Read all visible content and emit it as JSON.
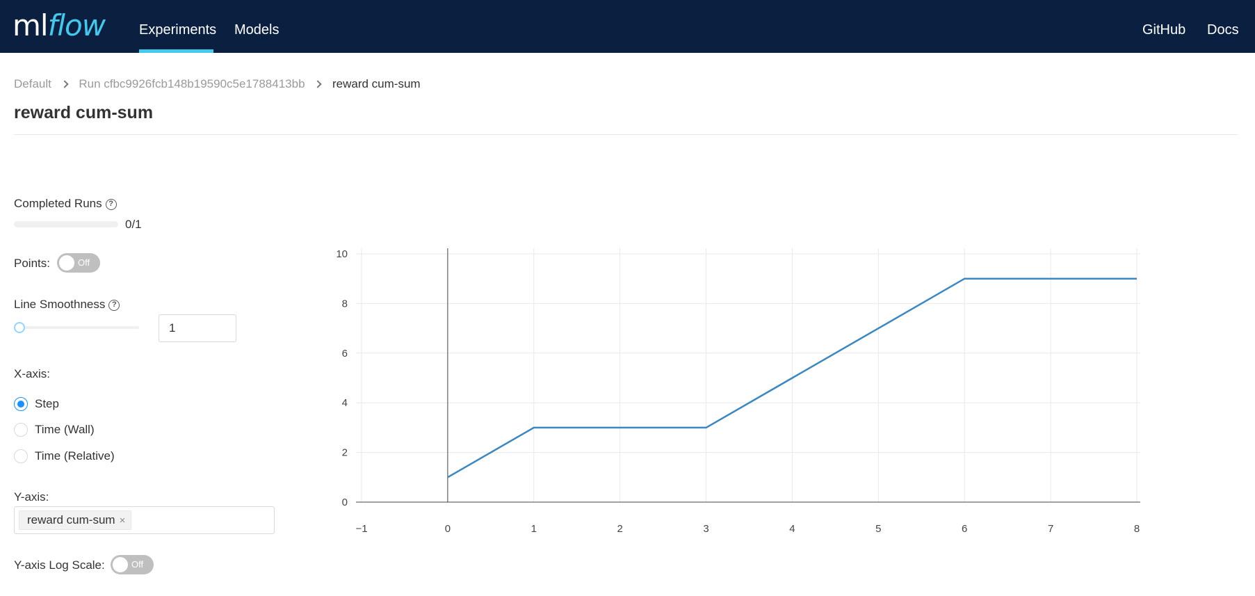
{
  "header": {
    "logo_ml": "ml",
    "logo_flow": "flow",
    "nav_left": [
      "Experiments",
      "Models"
    ],
    "nav_right": [
      "GitHub",
      "Docs"
    ],
    "active_nav": "Experiments",
    "background_color": "#0b2040",
    "accent_color": "#43c9ed"
  },
  "breadcrumb": {
    "items": [
      "Default",
      "Run cfbc9926fcb148b19590c5e1788413bb",
      "reward cum-sum"
    ]
  },
  "page_title": "reward cum-sum",
  "controls": {
    "completed_runs_label": "Completed Runs",
    "completed_runs_value": "0/1",
    "completed_runs_fraction": 0,
    "points_label": "Points:",
    "points_toggle": "Off",
    "line_smoothness_label": "Line Smoothness",
    "line_smoothness_value": "1",
    "xaxis_label": "X-axis:",
    "xaxis_options": [
      "Step",
      "Time (Wall)",
      "Time (Relative)"
    ],
    "xaxis_selected": "Step",
    "yaxis_label": "Y-axis:",
    "yaxis_selected": [
      "reward cum-sum"
    ],
    "yaxis_log_label": "Y-axis Log Scale:",
    "yaxis_log_toggle": "Off"
  },
  "chart_data": {
    "type": "line",
    "x": [
      0,
      1,
      3,
      6,
      8
    ],
    "series": [
      {
        "values": [
          1,
          3,
          3,
          9,
          9
        ],
        "color": "#3a87c2"
      }
    ],
    "xlim": [
      -1,
      8
    ],
    "ylim": [
      0,
      10
    ],
    "xticks": [
      "−1",
      "0",
      "1",
      "2",
      "3",
      "4",
      "5",
      "6",
      "7",
      "8"
    ],
    "yticks": [
      "0",
      "2",
      "4",
      "6",
      "8",
      "10"
    ],
    "grid": true,
    "title": "",
    "xlabel": "",
    "ylabel": ""
  }
}
